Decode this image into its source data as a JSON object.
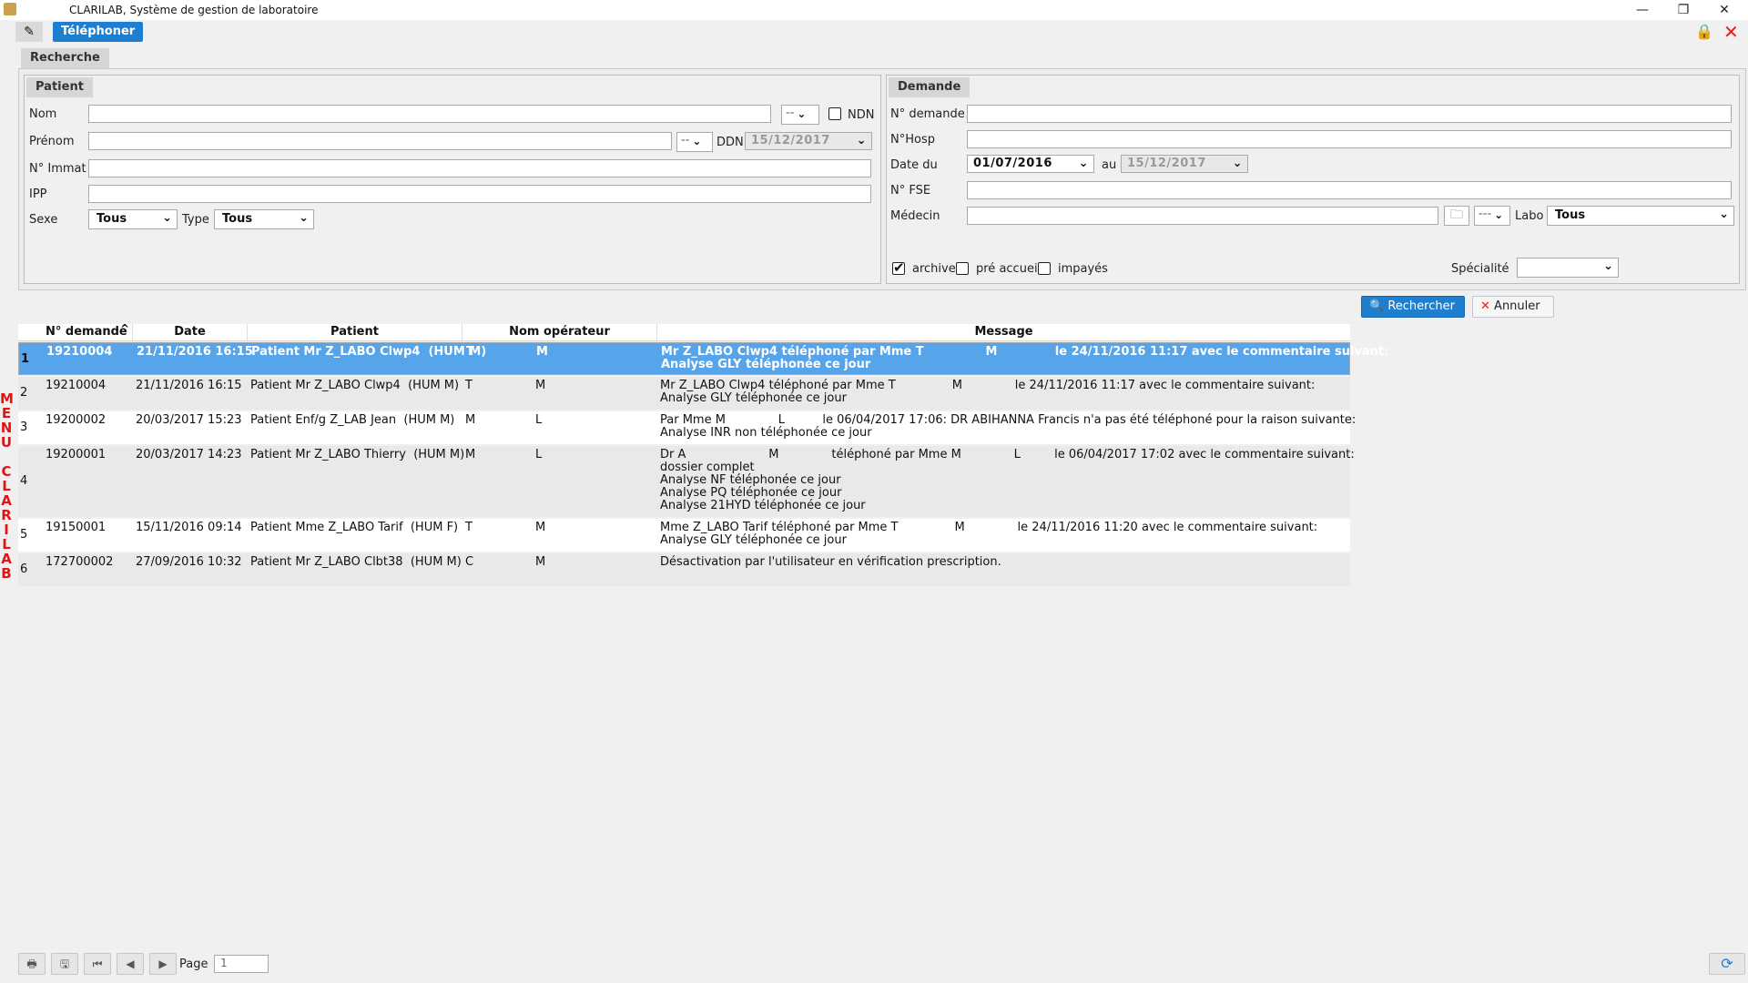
{
  "window": {
    "title": "CLARILAB, Système de gestion de laboratoire"
  },
  "toolbar": {
    "active_tab": "Téléphoner"
  },
  "search": {
    "section_label": "Recherche",
    "patient": {
      "label": "Patient",
      "nom_label": "Nom",
      "prenom_label": "Prénom",
      "immat_label": "N° Immat",
      "ipp_label": "IPP",
      "sexe_label": "Sexe",
      "sexe_value": "Tous",
      "type_label": "Type",
      "type_value": "Tous",
      "ndn_label": "NDN",
      "ddn_label": "DDN",
      "ddn_value": "15/12/2017"
    },
    "demande": {
      "label": "Demande",
      "numero_label": "N° demande",
      "hosp_label": "N°Hosp",
      "date_du_label": "Date du",
      "date_du_value": "01/07/2016",
      "au_label": "au",
      "au_value": "15/12/2017",
      "fse_label": "N° FSE",
      "medecin_label": "Médecin",
      "labo_label": "Labo",
      "labo_value": "Tous",
      "archive_label": "archive",
      "archive_checked": true,
      "preaccueil_label": "pré accueil",
      "impayes_label": "impayés",
      "specialite_label": "Spécialité"
    }
  },
  "actions": {
    "search_label": "Rechercher",
    "cancel_label": "Annuler"
  },
  "table": {
    "columns": [
      "N° demande",
      "Date",
      "Patient",
      "Nom opérateur",
      "Message"
    ],
    "rows": [
      {
        "num": "1",
        "demande": "19210004",
        "date": "21/11/2016 16:15",
        "patient": "Patient Mr Z_LABO Clwp4  (HUM M)",
        "op1": "T",
        "op2": "M",
        "message": [
          "Mr Z_LABO Clwp4 téléphoné par Mme T               M              le 24/11/2016 11:17 avec le commentaire suivant:",
          "Analyse GLY téléphonée ce jour"
        ]
      },
      {
        "num": "2",
        "demande": "19210004",
        "date": "21/11/2016 16:15",
        "patient": "Patient Mr Z_LABO Clwp4  (HUM M)",
        "op1": "T",
        "op2": "M",
        "message": [
          "Mr Z_LABO Clwp4 téléphoné par Mme T               M              le 24/11/2016 11:17 avec le commentaire suivant:",
          "Analyse GLY téléphonée ce jour"
        ]
      },
      {
        "num": "3",
        "demande": "19200002",
        "date": "20/03/2017 15:23",
        "patient": "Patient Enf/g Z_LAB Jean  (HUM M)",
        "op1": "M",
        "op2": "L",
        "message": [
          "Par Mme M              L          le 06/04/2017 17:06: DR ABIHANNA Francis n'a pas été téléphoné pour la raison suivante:",
          "Analyse INR non téléphonée ce jour"
        ]
      },
      {
        "num": "4",
        "demande": "19200001",
        "date": "20/03/2017 14:23",
        "patient": "Patient Mr Z_LABO Thierry  (HUM M)",
        "op1": "M",
        "op2": "L",
        "message": [
          "Dr A                      M              téléphoné par Mme M              L         le 06/04/2017 17:02 avec le commentaire suivant:",
          "dossier complet",
          "Analyse NF téléphonée ce jour",
          "Analyse PQ téléphonée ce jour",
          "Analyse 21HYD téléphonée ce jour"
        ]
      },
      {
        "num": "5",
        "demande": "19150001",
        "date": "15/11/2016 09:14",
        "patient": "Patient Mme Z_LABO Tarif  (HUM F)",
        "op1": "T",
        "op2": "M",
        "message": [
          "Mme Z_LABO Tarif téléphoné par Mme T               M              le 24/11/2016 11:20 avec le commentaire suivant:",
          "Analyse GLY téléphonée ce jour"
        ]
      },
      {
        "num": "6",
        "demande": "172700002",
        "date": "27/09/2016 10:32",
        "patient": "Patient Mr Z_LABO Clbt38  (HUM M)",
        "op1": "C",
        "op2": "M",
        "message": [
          "Désactivation par l'utilisateur en vérification prescription."
        ]
      }
    ]
  },
  "side_menu": {
    "letters": [
      "M",
      "E",
      "N",
      "U",
      "",
      "C",
      "L",
      "A",
      "R",
      "I",
      "L",
      "A",
      "B"
    ]
  },
  "footer": {
    "page_label": "Page",
    "page_value": "1"
  },
  "colors": {
    "accent": "#1e7fd0",
    "selected_row": "#56a4ea",
    "menu_red": "#e01414"
  }
}
